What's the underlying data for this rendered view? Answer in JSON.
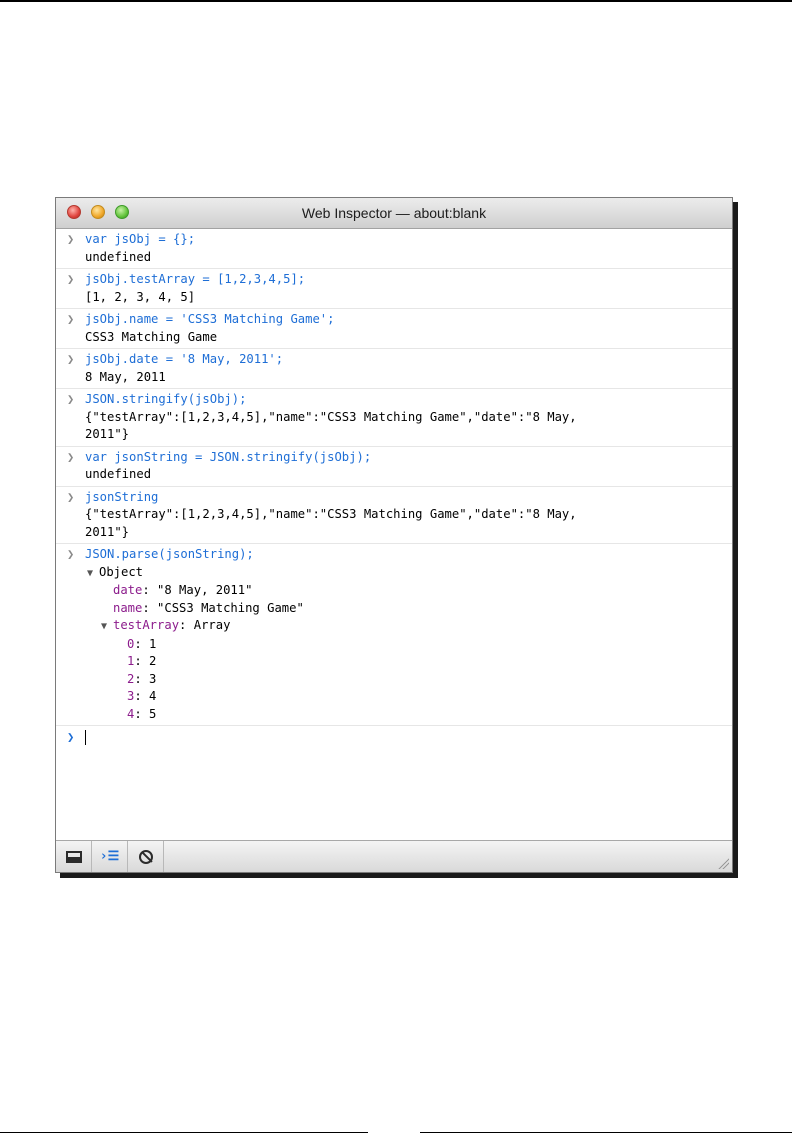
{
  "window": {
    "title": "Web Inspector — about:blank"
  },
  "console": {
    "entries": [
      {
        "command": "var jsObj = {};",
        "result": "undefined"
      },
      {
        "command": "jsObj.testArray = [1,2,3,4,5];",
        "result": "[1, 2, 3, 4, 5]"
      },
      {
        "command": "jsObj.name = 'CSS3 Matching Game';",
        "result": "CSS3 Matching Game"
      },
      {
        "command": "jsObj.date = '8 May, 2011';",
        "result": "8 May, 2011"
      },
      {
        "command": "JSON.stringify(jsObj);",
        "result": "{\"testArray\":[1,2,3,4,5],\"name\":\"CSS3 Matching Game\",\"date\":\"8 May,\n2011\"}"
      },
      {
        "command": "var jsonString = JSON.stringify(jsObj);",
        "result": "undefined"
      },
      {
        "command": "jsonString",
        "result": "{\"testArray\":[1,2,3,4,5],\"name\":\"CSS3 Matching Game\",\"date\":\"8 May,\n2011\"}"
      },
      {
        "command": "JSON.parse(jsonString);",
        "result": ""
      }
    ],
    "object_tree": {
      "label": "Object",
      "date_key": "date",
      "date_value": "\"8 May, 2011\"",
      "name_key": "name",
      "name_value": "\"CSS3 Matching Game\"",
      "array_key": "testArray",
      "array_label": "Array",
      "items": [
        {
          "key": "0",
          "value": "1"
        },
        {
          "key": "1",
          "value": "2"
        },
        {
          "key": "2",
          "value": "3"
        },
        {
          "key": "3",
          "value": "4"
        },
        {
          "key": "4",
          "value": "5"
        }
      ]
    },
    "input_value": ""
  },
  "icons": {
    "prompt": "chevron-right-icon",
    "disclosure_open": "triangle-down-icon",
    "dock": "dock-icon",
    "console": "console-icon",
    "clear": "clear-console-icon",
    "resize": "resize-grip-icon"
  },
  "colors": {
    "command": "#1e6ed6",
    "property_key": "#8c1c8c"
  }
}
